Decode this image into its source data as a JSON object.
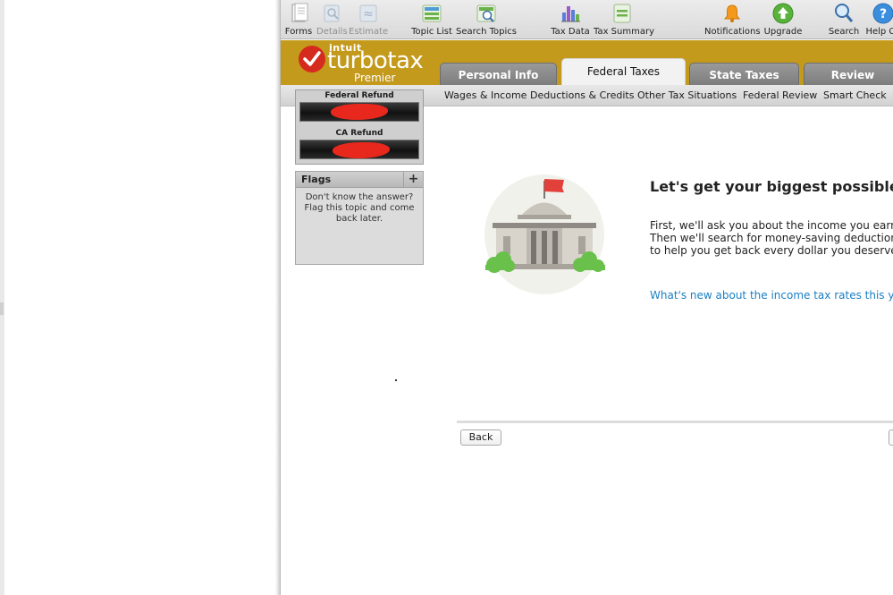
{
  "toolbar": {
    "forms": "Forms",
    "details": "Details",
    "estimate": "Estimate",
    "topic_list": "Topic List",
    "search_topics": "Search Topics",
    "tax_data": "Tax Data",
    "tax_summary": "Tax Summary",
    "notifications": "Notifications",
    "upgrade": "Upgrade",
    "search": "Search",
    "help_center": "Help Ce"
  },
  "brand": {
    "intuit": "intuit",
    "product": "turbotax",
    "edition": "Premier",
    "color": "#c49a1c"
  },
  "tabs": {
    "personal_info": "Personal Info",
    "federal_taxes": "Federal Taxes",
    "state_taxes": "State Taxes",
    "review": "Review",
    "active": "Federal Taxes"
  },
  "subnav": {
    "wages_income": "Wages & Income",
    "deductions_credits": "Deductions & Credits",
    "other_tax_situations": "Other Tax Situations",
    "federal_review": "Federal Review",
    "smart_check": "Smart Check"
  },
  "refund": {
    "federal_label": "Federal Refund",
    "ca_label": "CA Refund"
  },
  "flags": {
    "title": "Flags",
    "add_symbol": "+",
    "hint": "Don't know the answer? Flag this topic and come back later."
  },
  "main": {
    "headline": "Let's get your biggest possible ref",
    "body_line1": "First, we'll ask you about the income you earned la",
    "body_line2": "Then we'll search for money-saving deductions an",
    "body_line3": "to help you get back every dollar you deserve.",
    "link": "What's new about the income tax rates this year",
    "back_button": "Back"
  }
}
